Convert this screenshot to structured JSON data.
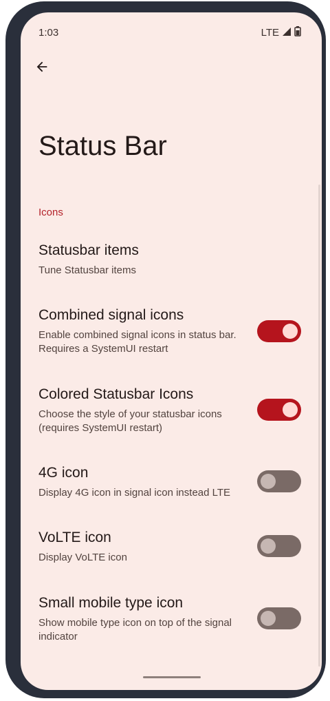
{
  "status_bar": {
    "time": "1:03",
    "network": "LTE"
  },
  "toolbar": {
    "title": "Status Bar"
  },
  "section": {
    "header": "Icons"
  },
  "preferences": [
    {
      "title": "Statusbar items",
      "summary": "Tune Statusbar items"
    },
    {
      "title": "Combined signal icons",
      "summary": "Enable combined signal icons in status bar. Requires a SystemUI restart",
      "checked": true
    },
    {
      "title": "Colored Statusbar Icons",
      "summary": "Choose the style of your statusbar icons (requires SystemUI restart)",
      "checked": true
    },
    {
      "title": "4G icon",
      "summary": "Display 4G icon in signal icon instead LTE",
      "checked": false
    },
    {
      "title": "VoLTE icon",
      "summary": "Display VoLTE icon",
      "checked": false
    },
    {
      "title": "Small mobile type icon",
      "summary": "Show mobile type icon on top of the signal indicator",
      "checked": false
    }
  ],
  "colors": {
    "background": "#fbebe7",
    "accent": "#b5141d",
    "switch_off": "#7a6a66"
  }
}
